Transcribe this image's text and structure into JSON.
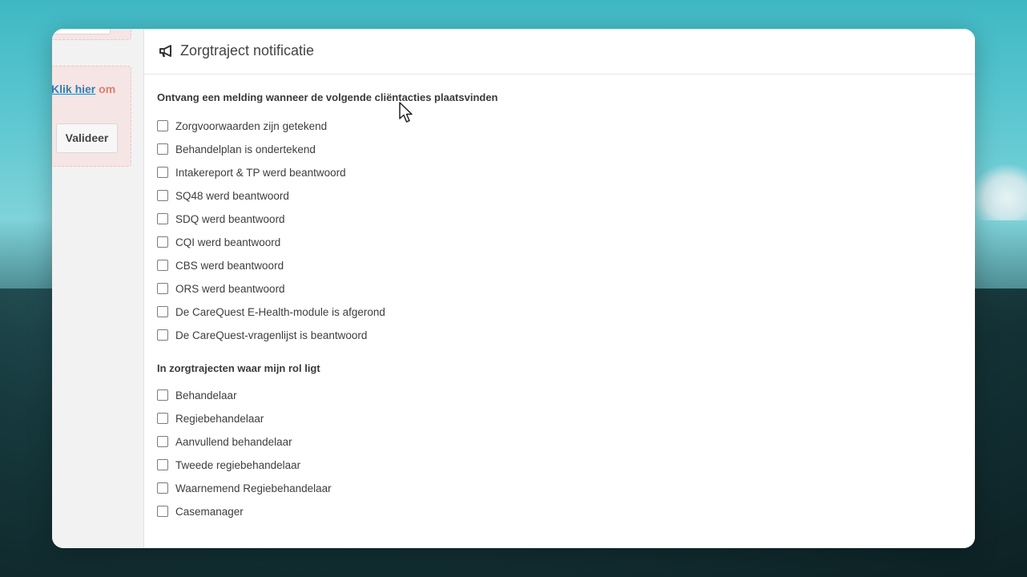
{
  "sidebar": {
    "link_text": "Klik hier",
    "link_suffix": "om",
    "validate_button": "Valideer"
  },
  "panel": {
    "title": "Zorgtraject notificatie",
    "icon": "megaphone-icon",
    "section1": {
      "title": "Ontvang een melding wanneer de volgende cliëntacties plaatsvinden",
      "options": [
        "Zorgvoorwaarden zijn getekend",
        "Behandelplan is ondertekend",
        "Intakereport & TP werd beantwoord",
        "SQ48 werd beantwoord",
        "SDQ werd beantwoord",
        "CQI werd beantwoord",
        "CBS werd beantwoord",
        "ORS werd beantwoord",
        "De CareQuest E-Health-module is afgerond",
        "De CareQuest-vragenlijst is beantwoord"
      ]
    },
    "section2": {
      "title": "In zorgtrajecten waar mijn rol ligt",
      "options": [
        "Behandelaar",
        "Regiebehandelaar",
        "Aanvullend behandelaar",
        "Tweede regiebehandelaar",
        "Waarnemend Regiebehandelaar",
        "Casemanager"
      ]
    }
  },
  "colors": {
    "link": "#2f7fb8",
    "alert_text": "#d9806f",
    "alert_bg": "#f6e5e5"
  }
}
